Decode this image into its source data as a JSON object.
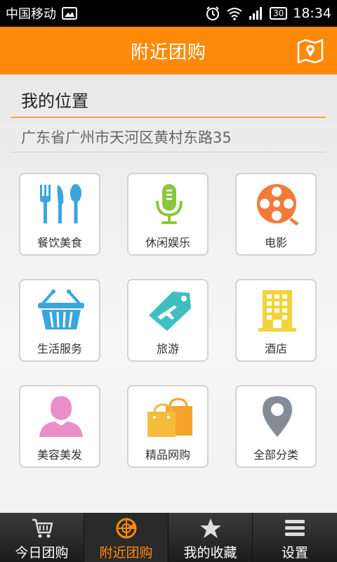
{
  "status_bar": {
    "carrier": "中国移动",
    "battery": "30",
    "time": "18:34"
  },
  "header": {
    "title": "附近团购"
  },
  "location": {
    "title": "我的位置",
    "address": "广东省广州市天河区黄村东路35"
  },
  "categories": [
    {
      "label": "餐饮美食",
      "icon": "utensils-icon"
    },
    {
      "label": "休闲娱乐",
      "icon": "microphone-icon"
    },
    {
      "label": "电影",
      "icon": "film-reel-icon"
    },
    {
      "label": "生活服务",
      "icon": "basket-icon"
    },
    {
      "label": "旅游",
      "icon": "plane-tag-icon"
    },
    {
      "label": "酒店",
      "icon": "building-icon"
    },
    {
      "label": "美容美发",
      "icon": "woman-icon"
    },
    {
      "label": "精品网购",
      "icon": "shopping-bags-icon"
    },
    {
      "label": "全部分类",
      "icon": "map-pin-icon"
    }
  ],
  "bottom_nav": [
    {
      "label": "今日团购",
      "icon": "cart-icon"
    },
    {
      "label": "附近团购",
      "icon": "radar-icon",
      "active": true
    },
    {
      "label": "我的收藏",
      "icon": "star-icon"
    },
    {
      "label": "设置",
      "icon": "menu-icon"
    }
  ],
  "colors": {
    "accent": "#ff8a0a",
    "blue": "#3aa6dc",
    "green": "#8cc63e"
  }
}
